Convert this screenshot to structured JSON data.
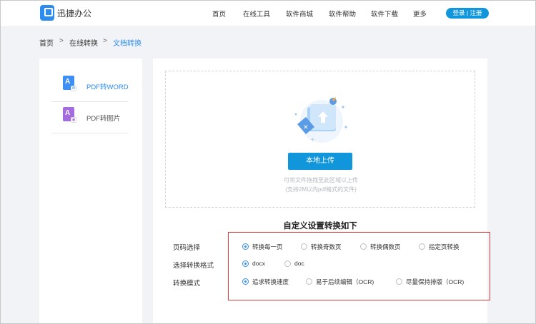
{
  "header": {
    "brand": "迅捷办公",
    "nav": [
      "首页",
      "在线工具",
      "软件商城",
      "软件帮助",
      "软件下载",
      "更多"
    ],
    "auth": "登录 | 注册"
  },
  "breadcrumb": [
    "首页",
    "在线转换",
    "文档转换"
  ],
  "sidebar": {
    "items": [
      {
        "label": "PDF转WORD",
        "active": true
      },
      {
        "label": "PDF转图片",
        "active": false
      }
    ]
  },
  "upload": {
    "button": "本地上传",
    "hint1": "可将文件拖拽至此区域以上传",
    "hint2": "(支持2M以内pdf格式的文件)"
  },
  "settings": {
    "title": "自定义设置转换如下",
    "rows": [
      {
        "label": "页码选择",
        "options": [
          "转换每一页",
          "转换奇数页",
          "转换偶数页",
          "指定页转换"
        ],
        "selected": 0
      },
      {
        "label": "选择转换格式",
        "options": [
          "docx",
          "doc"
        ],
        "selected": 0
      },
      {
        "label": "转换模式",
        "options": [
          "追求转换速度",
          "易于后续编辑（OCR)",
          "尽量保持排版（OCR)"
        ],
        "selected": 0
      }
    ]
  },
  "colors": {
    "accent": "#1296db",
    "link": "#2d8cf0",
    "highlight": "#d93a3a"
  }
}
